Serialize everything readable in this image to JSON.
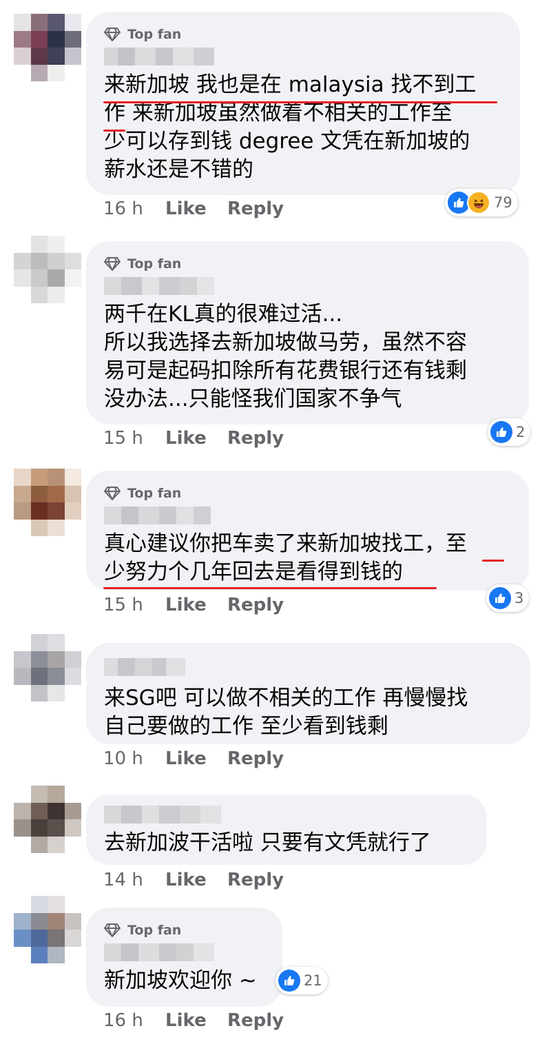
{
  "top_fan_label": "Top fan",
  "actions": {
    "like": "Like",
    "reply": "Reply"
  },
  "comments": [
    {
      "top_fan": true,
      "text": "来新加坡 我也是在 malaysia 找不到工\n作 来新加坡虽然做着不相关的工作至\n少可以存到钱 degree 文凭在新加坡的\n薪水还是不错的",
      "time": "16 h",
      "reactions": {
        "types": [
          "like",
          "haha"
        ],
        "count": "79"
      }
    },
    {
      "top_fan": true,
      "text": "两千在KL真的很难过活...\n所以我选择去新加坡做马劳，虽然不容\n易可是起码扣除所有花费银行还有钱剩\n没办法...只能怪我们国家不争气",
      "time": "15 h",
      "reactions": {
        "types": [
          "like"
        ],
        "count": "2"
      }
    },
    {
      "top_fan": true,
      "text": "真心建议你把车卖了来新加坡找工，至\n少努力个几年回去是看得到钱的",
      "time": "15 h",
      "reactions": {
        "types": [
          "like"
        ],
        "count": "3"
      }
    },
    {
      "top_fan": false,
      "text": "来SG吧 可以做不相关的工作 再慢慢找\n自己要做的工作 至少看到钱剩",
      "time": "10 h",
      "reactions": null
    },
    {
      "top_fan": false,
      "text": "去新加波干活啦 只要有文凭就行了",
      "time": "14 h",
      "reactions": null
    },
    {
      "top_fan": true,
      "text": "新加坡欢迎你 ~",
      "time": "16 h",
      "reactions": {
        "types": [
          "like"
        ],
        "count": "21"
      }
    }
  ],
  "colors": {
    "bubble": "#f0f2f5",
    "meta": "#65676b",
    "like_blue": "#1877f2",
    "underline_red": "#e41e26"
  }
}
